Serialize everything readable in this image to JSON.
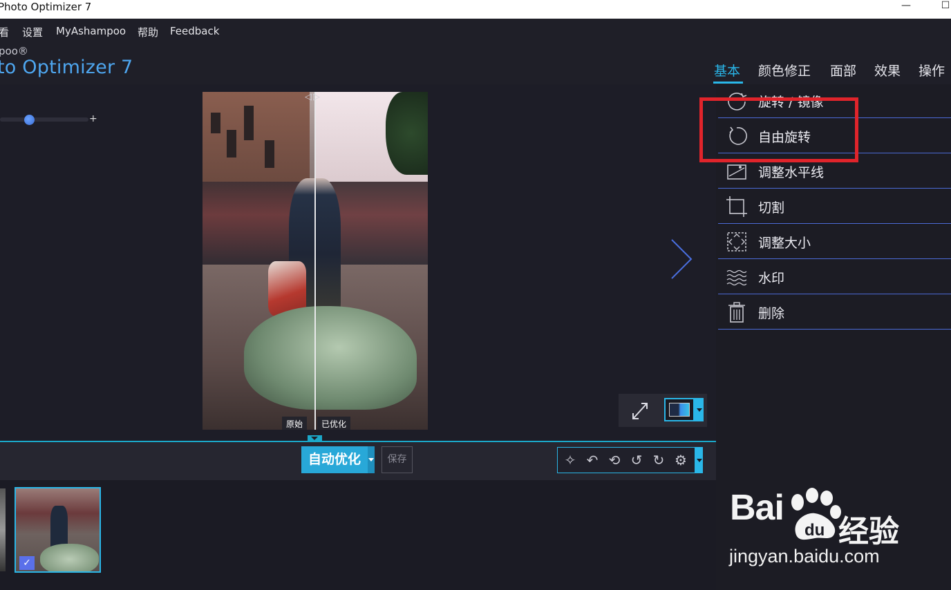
{
  "window": {
    "title": "Photo Optimizer 7",
    "minimize_glyph": "—",
    "maximize_glyph": "☐"
  },
  "menu": {
    "items": [
      "看",
      "设置",
      "MyAshampoo",
      "帮助",
      "Feedback"
    ]
  },
  "brand": {
    "small": "poo®",
    "big": "to Optimizer 7"
  },
  "tabs": [
    {
      "label": "基本",
      "active": true
    },
    {
      "label": "颜色修正",
      "active": false
    },
    {
      "label": "面部",
      "active": false
    },
    {
      "label": "效果",
      "active": false
    },
    {
      "label": "操作",
      "active": false
    }
  ],
  "zoom_slider": {
    "plus": "+"
  },
  "compare": {
    "before_label": "原始",
    "after_label": "已优化",
    "divider_arrows": "◁▷"
  },
  "operations": [
    {
      "label": "旋转 / 镜像",
      "icon": "rotate-mirror-icon"
    },
    {
      "label": "自由旋转",
      "icon": "free-rotate-icon"
    },
    {
      "label": "调整水平线",
      "icon": "horizon-icon"
    },
    {
      "label": "切割",
      "icon": "crop-icon"
    },
    {
      "label": "调整大小",
      "icon": "resize-icon"
    },
    {
      "label": "水印",
      "icon": "watermark-icon"
    },
    {
      "label": "删除",
      "icon": "trash-icon"
    }
  ],
  "toolbar": {
    "auto_optimize": "自动优化",
    "save": "保存",
    "edit_tools": [
      {
        "icon": "magic-stars-icon",
        "glyph": "✧"
      },
      {
        "icon": "undo-icon",
        "glyph": "↶"
      },
      {
        "icon": "undo-all-icon",
        "glyph": "⟲"
      },
      {
        "icon": "rotate-left-90-icon",
        "glyph": "↺"
      },
      {
        "icon": "rotate-right-90-icon",
        "glyph": "↻"
      },
      {
        "icon": "settings-gear-icon",
        "glyph": "⚙"
      }
    ]
  },
  "filmstrip": {
    "check_glyph": "✓"
  },
  "watermark": {
    "logo_bai": "Bai",
    "logo_du": "du",
    "logo_cn": "经验",
    "url": "jingyan.baidu.com"
  },
  "colors": {
    "accent": "#2ab7e8",
    "highlight": "#e0242b",
    "divider": "#4c6bd8"
  }
}
